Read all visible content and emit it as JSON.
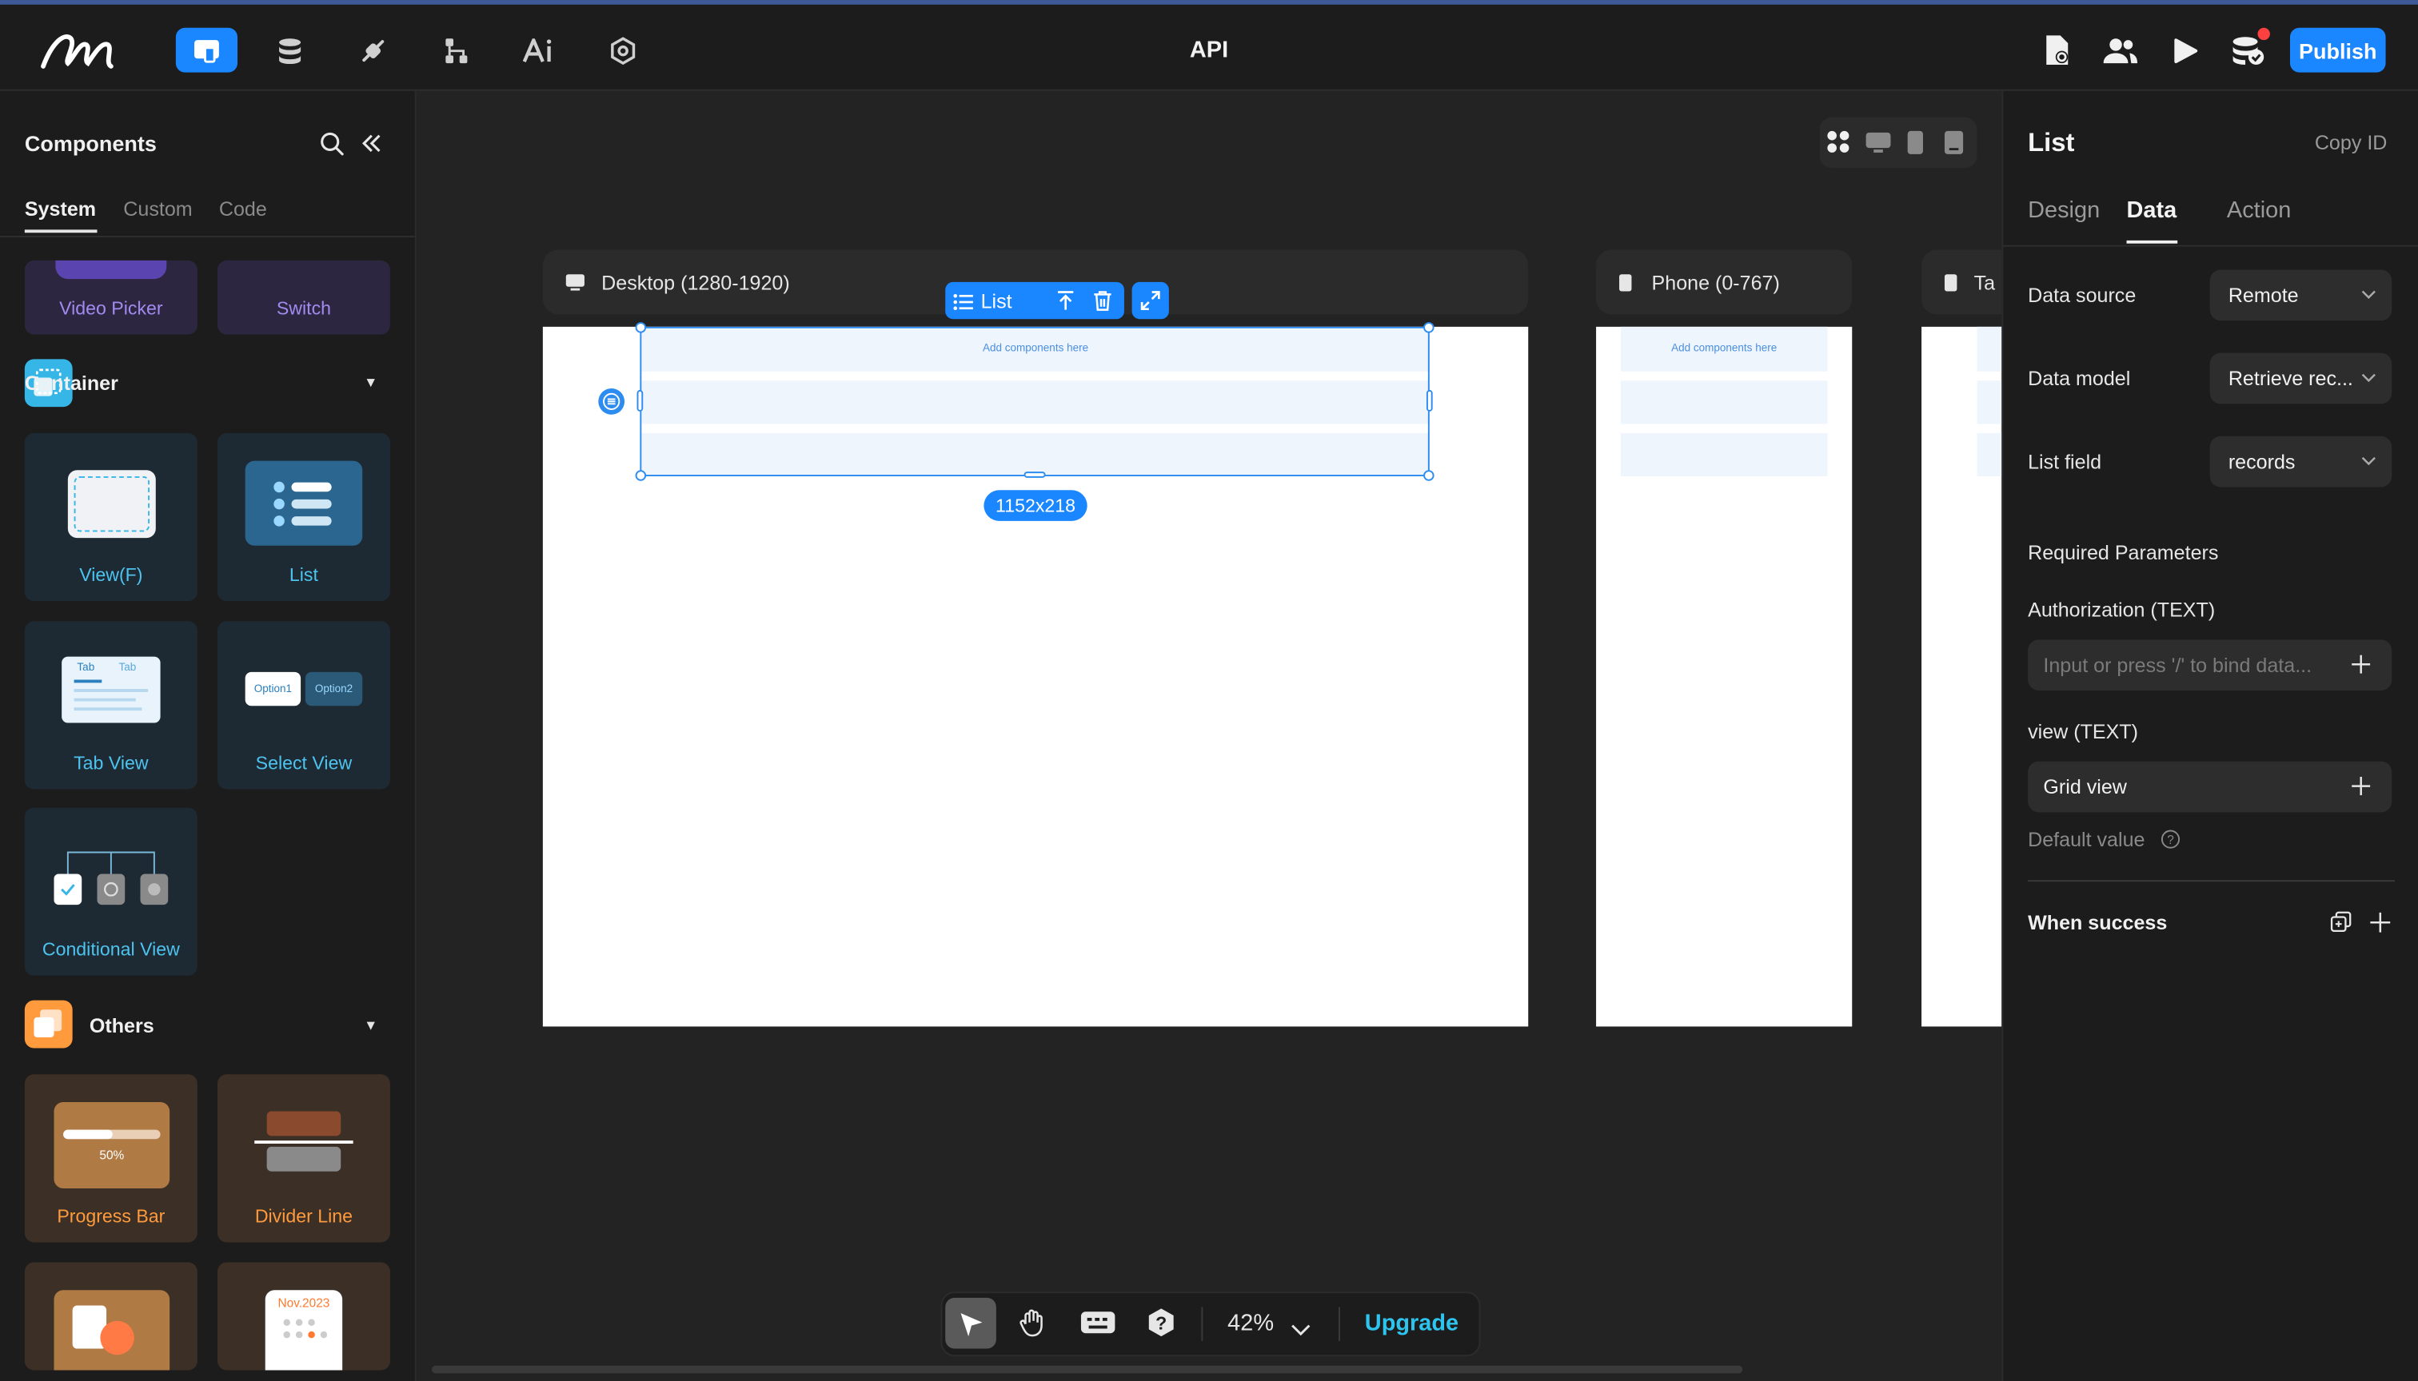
{
  "header": {
    "title": "API",
    "publish_label": "Publish",
    "nav_icons": [
      "pages-icon",
      "database-icon",
      "plugin-icon",
      "workflow-icon",
      "ai-icon",
      "settings-icon"
    ],
    "right_icons": [
      "page-settings-icon",
      "users-icon",
      "preview-play-icon",
      "database-check-icon"
    ]
  },
  "left_panel": {
    "title": "Components",
    "tabs": [
      "System",
      "Custom",
      "Code"
    ],
    "active_tab": "System",
    "partial_items": [
      "Video Picker",
      "Switch"
    ],
    "sections": [
      {
        "name": "Container",
        "items": [
          "View(F)",
          "List",
          "Tab View",
          "Select View",
          "Conditional View"
        ]
      },
      {
        "name": "Others",
        "items": [
          "Progress Bar",
          "Divider Line"
        ]
      }
    ],
    "tab_view_tabs": [
      "Tab",
      "Tab"
    ],
    "select_view_options": [
      "Option1",
      "Option2"
    ],
    "progress_value_text": "50%",
    "progress_fraction": 0.5,
    "calendar_text": "Nov.2023"
  },
  "canvas": {
    "frames": [
      {
        "name": "Desktop (1280-1920)"
      },
      {
        "name": "Phone (0-767)"
      },
      {
        "name": "Ta"
      }
    ],
    "placeholder": "Add components here",
    "selection": {
      "label": "List",
      "size": "1152x218"
    }
  },
  "right_panel": {
    "title": "List",
    "copy_id": "Copy ID",
    "tabs": [
      "Design",
      "Data",
      "Action"
    ],
    "active_tab": "Data",
    "data_source_label": "Data source",
    "data_source_value": "Remote",
    "data_model_label": "Data model",
    "data_model_value": "Retrieve rec...",
    "list_field_label": "List field",
    "list_field_value": "records",
    "required_params": "Required Parameters",
    "auth_label": "Authorization (TEXT)",
    "auth_placeholder": "Input or press '/' to bind data...",
    "view_label": "view (TEXT)",
    "view_value": "Grid view",
    "default_value": "Default value",
    "when_success": "When success"
  },
  "bottom_toolbar": {
    "zoom": "42%",
    "upgrade": "Upgrade"
  },
  "colors": {
    "accent": "#1a86ff",
    "upgrade": "#2ec4f0",
    "orange": "#ff9a3d",
    "cyan": "#4dc3f0"
  }
}
